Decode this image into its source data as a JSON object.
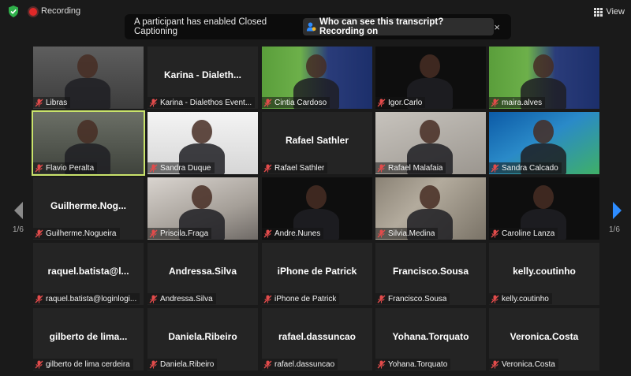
{
  "topbar": {
    "recording_label": "Recording",
    "view_label": "View"
  },
  "banner": {
    "message": "A participant has enabled Closed Captioning",
    "link_label": "Who can see this transcript? Recording on",
    "close_glyph": "×"
  },
  "pagination": {
    "left": "1/6",
    "right": "1/6"
  },
  "colors": {
    "recording": "#e02828",
    "active_speaker": "#c9e36b",
    "nav_right": "#2d8cff",
    "mute_icon": "#e24b4b"
  },
  "tiles": [
    {
      "display": "",
      "name": "Libras",
      "video": "v-gray"
    },
    {
      "display": "Karina - Dialeth...",
      "name": "Karina - Dialethos Event...",
      "video": ""
    },
    {
      "display": "",
      "name": "Cintia Cardoso",
      "video": "v-green"
    },
    {
      "display": "",
      "name": "Igor.Carlo",
      "video": "v-dark"
    },
    {
      "display": "",
      "name": "maira.alves",
      "video": "v-green"
    },
    {
      "display": "",
      "name": "Flavio Peralta",
      "video": "v-room"
    },
    {
      "display": "",
      "name": "Sandra Duque",
      "video": "v-white"
    },
    {
      "display": "Rafael Sathler",
      "name": "Rafael Sathler",
      "video": ""
    },
    {
      "display": "",
      "name": "Rafael Malafaia",
      "video": "v-office"
    },
    {
      "display": "",
      "name": "Sandra Calcado",
      "video": "v-blue"
    },
    {
      "display": "Guilherme.Nog...",
      "name": "Guilherme.Nogueira",
      "video": ""
    },
    {
      "display": "",
      "name": "Priscila.Fraga",
      "video": "v-light"
    },
    {
      "display": "",
      "name": "Andre.Nunes",
      "video": "v-dark"
    },
    {
      "display": "",
      "name": "Silvia.Medina",
      "video": "v-stone"
    },
    {
      "display": "",
      "name": "Caroline Lanza",
      "video": "v-dark"
    },
    {
      "display": "raquel.batista@l...",
      "name": "raquel.batista@loginlogi...",
      "video": ""
    },
    {
      "display": "Andressa.Silva",
      "name": "Andressa.Silva",
      "video": ""
    },
    {
      "display": "iPhone de Patrick",
      "name": "iPhone de Patrick",
      "video": ""
    },
    {
      "display": "Francisco.Sousa",
      "name": "Francisco.Sousa",
      "video": ""
    },
    {
      "display": "kelly.coutinho",
      "name": "kelly.coutinho",
      "video": ""
    },
    {
      "display": "gilberto de lima...",
      "name": "gilberto de lima cerdeira",
      "video": ""
    },
    {
      "display": "Daniela.Ribeiro",
      "name": "Daniela.Ribeiro",
      "video": ""
    },
    {
      "display": "rafael.dassuncao",
      "name": "rafael.dassuncao",
      "video": ""
    },
    {
      "display": "Yohana.Torquato",
      "name": "Yohana.Torquato",
      "video": ""
    },
    {
      "display": "Veronica.Costa",
      "name": "Veronica.Costa",
      "video": ""
    }
  ],
  "active_tile_index": 5
}
